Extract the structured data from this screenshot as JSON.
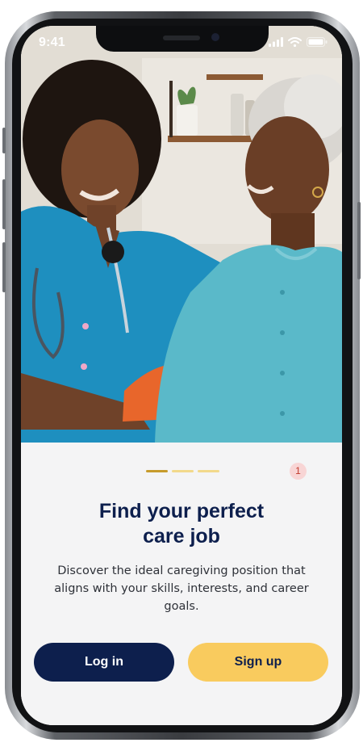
{
  "status_bar": {
    "time": "9:41",
    "icons": [
      "cellular-signal-icon",
      "wifi-icon",
      "battery-icon"
    ]
  },
  "hero": {
    "icon": "hero-photo",
    "description_hidden": ""
  },
  "onboarding": {
    "pager": {
      "total": 3,
      "active_index": 0
    },
    "notification_count": "1",
    "title_line1": "Find your perfect",
    "title_line2": "care job",
    "description": "Discover the ideal caregiving position that aligns with your skills, interests, and career goals."
  },
  "actions": {
    "login_label": "Log in",
    "signup_label": "Sign up"
  },
  "colors": {
    "navy": "#0d1f4d",
    "yellow": "#f9cb5e",
    "pager_active": "#c79b2c",
    "pager_inactive": "#f2d98b",
    "badge_bg": "#f8d5d5",
    "badge_text": "#c0392b",
    "panel_bg": "#f4f4f5"
  }
}
